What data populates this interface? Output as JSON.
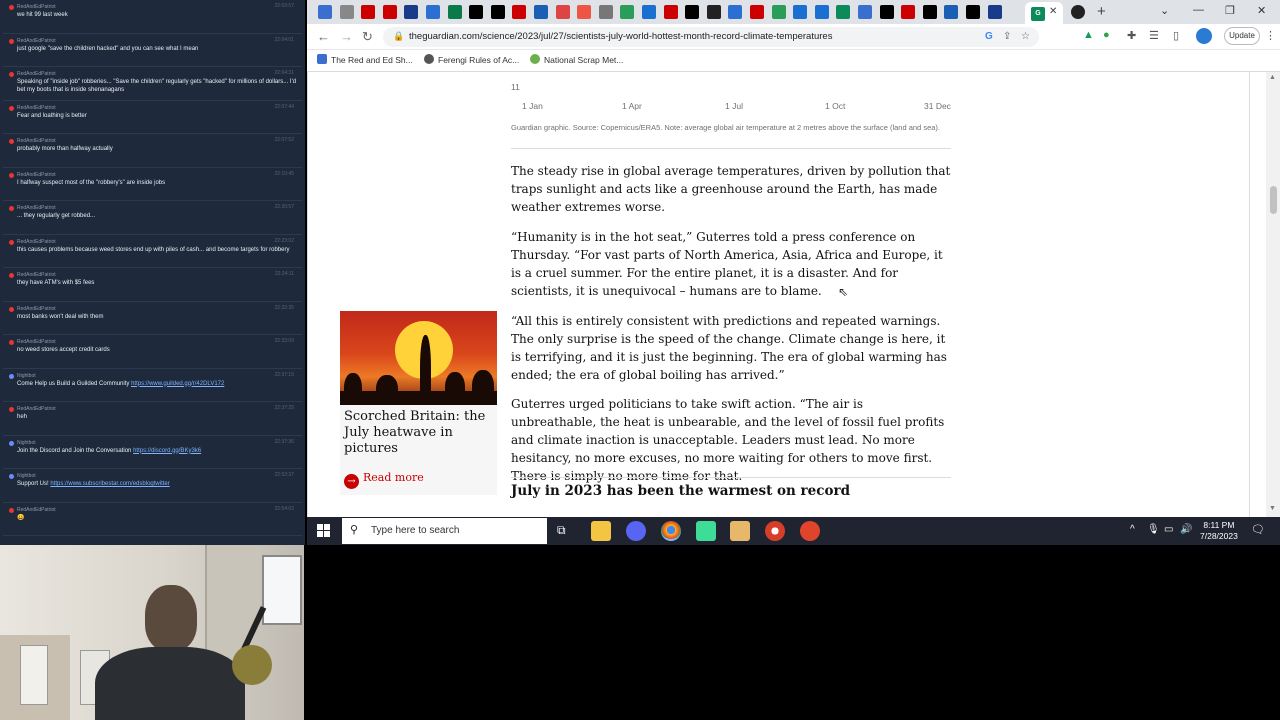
{
  "chat": {
    "messages": [
      {
        "name": "RedAndEdPatriot",
        "time": "22:03:57",
        "text": "we hit 99 last week",
        "dot": "red"
      },
      {
        "name": "RedAndEdPatriot",
        "time": "22:04:01",
        "text": "just google \"save the children hacked\" and you can see what I mean",
        "dot": "red"
      },
      {
        "name": "RedAndEdPatriot",
        "time": "22:04:31",
        "text": "Speaking of \"inside job\" robberies... \"Save the children\" regularly gets \"hacked\" for millions of dollars... I'd bet my boots that is inside shenanagans",
        "dot": "red"
      },
      {
        "name": "RedAndEdPatriot",
        "time": "22:07:44",
        "text": "Fear and loathing is better",
        "dot": "red"
      },
      {
        "name": "RedAndEdPatriot",
        "time": "22:07:52",
        "text": "probably more than halfway actually",
        "dot": "red"
      },
      {
        "name": "RedAndEdPatriot",
        "time": "22:10:45",
        "text": "I halfway suspect most of the \"robbery's\" are inside jobs",
        "dot": "red"
      },
      {
        "name": "RedAndEdPatriot",
        "time": "22:20:57",
        "text": "... they regularly get robbed...",
        "dot": "red"
      },
      {
        "name": "RedAndEdPatriot",
        "time": "22:23:02",
        "text": "this causes problems because weed stores end up with piles of cash... and become targets for robbery",
        "dot": "red"
      },
      {
        "name": "RedAndEdPatriot",
        "time": "22:24:11",
        "text": "they have ATM's with $5 fees",
        "dot": "red"
      },
      {
        "name": "RedAndEdPatriot",
        "time": "22:32:35",
        "text": "most banks won't deal with them",
        "dot": "red"
      },
      {
        "name": "RedAndEdPatriot",
        "time": "22:33:09",
        "text": "no weed stores accept credit cards",
        "dot": "red"
      },
      {
        "name": "Nightbot",
        "time": "22:37:15",
        "text": "Come Help us Build a Guilded Community ",
        "link": "https://www.guilded.gg/r/42DLV172",
        "dot": "blue"
      },
      {
        "name": "RedAndEdPatriot",
        "time": "22:37:25",
        "text": "heh",
        "dot": "red"
      },
      {
        "name": "Nightbot",
        "time": "22:37:36",
        "text": "Join the Discord and Join the Conversation ",
        "link": "https://discord.gg/BKy3k6",
        "dot": "blue"
      },
      {
        "name": "Nightbot",
        "time": "22:52:37",
        "text": "Support Us! ",
        "link": "https://www.subscribestar.com/edsblogtwitter",
        "dot": "blue"
      },
      {
        "name": "RedAndEdPatriot",
        "time": "22:54:02",
        "text": "😀",
        "dot": "red"
      }
    ]
  },
  "browser": {
    "url": "theguardian.com/science/2023/jul/27/scientists-july-world-hottest-month-record-climate-temperatures",
    "update_label": "Update",
    "bookmarks": [
      "The Red and Ed Sh...",
      "Ferengi Rules of Ac...",
      "National Scrap Met..."
    ]
  },
  "article": {
    "chart_axis": {
      "y_tick": "11",
      "x_ticks": [
        "1 Jan",
        "1 Apr",
        "1 Jul",
        "1 Oct",
        "31 Dec"
      ]
    },
    "chart_caption": "Guardian graphic. Source: Copernicus/ERA5. Note: average global air temperature at 2 metres above the surface (land and sea).",
    "paragraphs": [
      "The steady rise in global average temperatures, driven by pollution that traps sunlight and acts like a greenhouse around the Earth, has made weather extremes worse.",
      "“Humanity is in the hot seat,” Guterres told a press conference on Thursday. “For vast parts of North America, Asia, Africa and Europe, it is a cruel summer. For the entire planet, it is a disaster. And for scientists, it is unequivocal – humans are to blame.",
      "“All this is entirely consistent with predictions and repeated warnings. The only surprise is the speed of the change. Climate change is here, it is terrifying, and it is just the beginning. The era of global warming has ended; the era of global boiling has arrived.”",
      "Guterres urged politicians to take swift action. “The air is unbreathable, the heat is unbearable, and the level of fossil fuel profits and climate inaction is unacceptable. Leaders must lead. No more hesitancy, no more excuses, no more waiting for others to move first. There is simply no more time for that."
    ],
    "subheading": "July in 2023 has been the warmest on record",
    "promo": {
      "title": "Scorched Britain: the July heatwave in pictures",
      "read_more": "Read more"
    }
  },
  "taskbar": {
    "search_placeholder": "Type here to search",
    "time": "8:11 PM",
    "date": "7/28/2023"
  },
  "colors": {
    "guardian_red": "#c70000",
    "chat_bg": "#1e2a3b",
    "taskbar_bg": "#1f2430"
  }
}
